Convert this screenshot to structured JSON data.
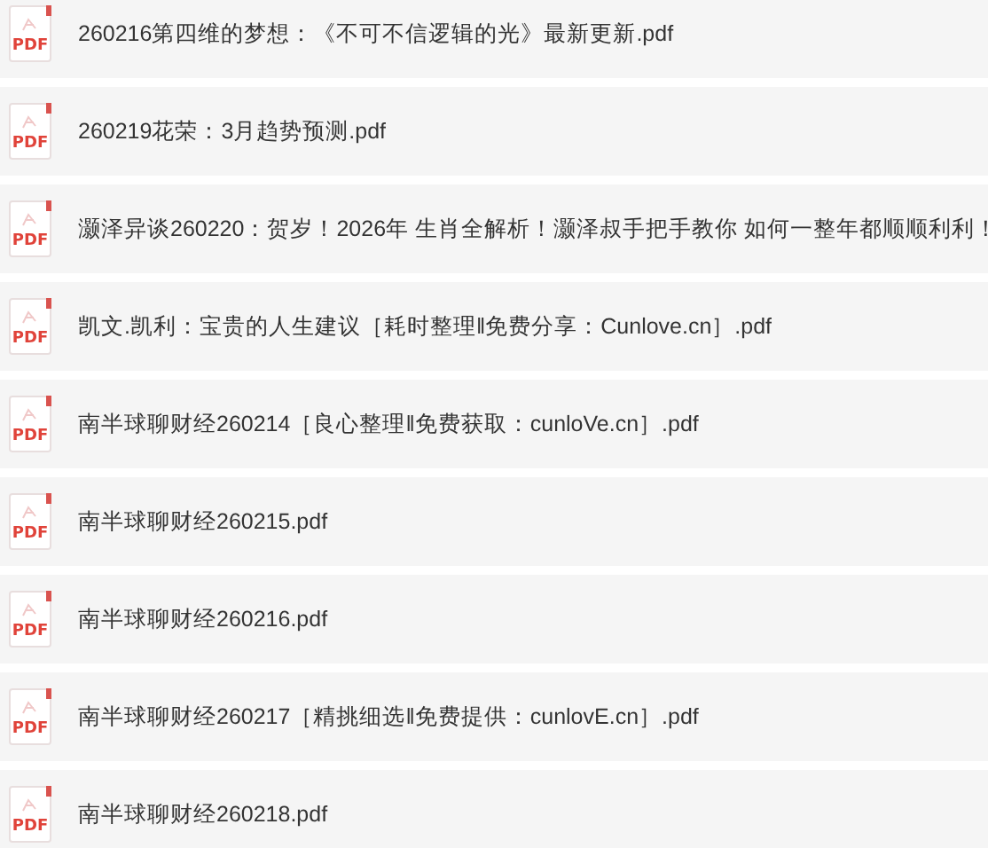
{
  "files": [
    {
      "badge": "PDF",
      "name": "260216第四维的梦想：《不可不信逻辑的光》最新更新.pdf"
    },
    {
      "badge": "PDF",
      "name": "260219花荣：3月趋势预测.pdf"
    },
    {
      "badge": "PDF",
      "name": "灏泽异谈260220：贺岁！2026年 生肖全解析！灏泽叔手把手教你 如何一整年都顺顺利利！"
    },
    {
      "badge": "PDF",
      "name": "凯文.凯利：宝贵的人生建议［耗时整理‖免费分享：Cunlove.cn］.pdf"
    },
    {
      "badge": "PDF",
      "name": "南半球聊财经260214［良心整理‖免费获取：cunloVe.cn］.pdf"
    },
    {
      "badge": "PDF",
      "name": "南半球聊财经260215.pdf"
    },
    {
      "badge": "PDF",
      "name": "南半球聊财经260216.pdf"
    },
    {
      "badge": "PDF",
      "name": "南半球聊财经260217［精挑细选‖免费提供：cunlovE.cn］.pdf"
    },
    {
      "badge": "PDF",
      "name": "南半球聊财经260218.pdf"
    }
  ]
}
